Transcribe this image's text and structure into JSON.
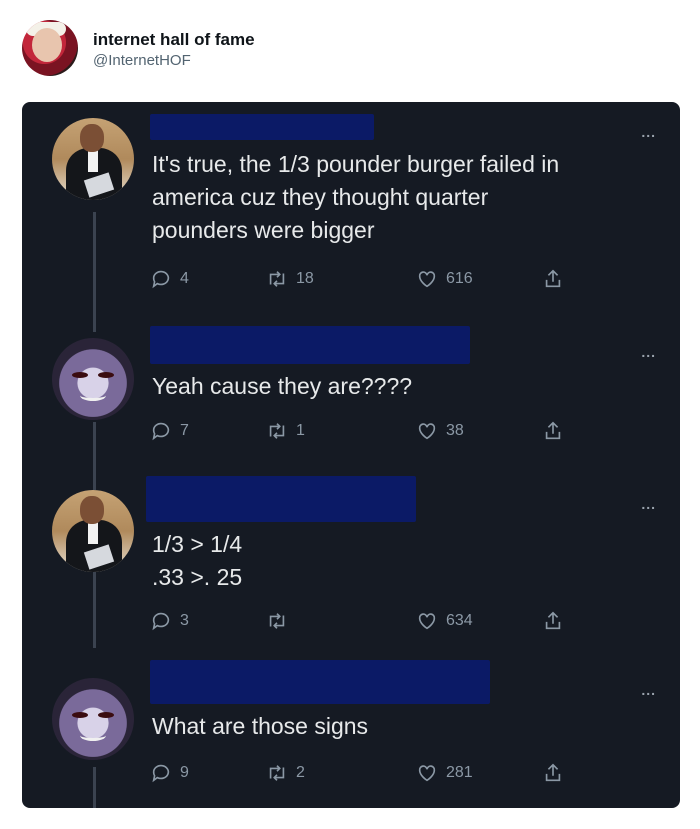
{
  "account": {
    "name": "internet hall of fame",
    "handle": "@InternetHOF"
  },
  "more_label": "...",
  "tweets": [
    {
      "lines": [
        "It's true, the 1/3 pounder burger failed in",
        "america cuz they thought quarter",
        "pounders were bigger"
      ],
      "replies": "4",
      "retweets": "18",
      "likes": "616"
    },
    {
      "lines": [
        "Yeah cause they are????"
      ],
      "replies": "7",
      "retweets": "1",
      "likes": "38"
    },
    {
      "lines": [
        "1/3 > 1/4",
        ".33 >. 25"
      ],
      "replies": "3",
      "retweets": "",
      "likes": "634"
    },
    {
      "lines": [
        "What are those signs"
      ],
      "replies": "9",
      "retweets": "2",
      "likes": "281"
    }
  ],
  "icons": {
    "reply": "reply-icon",
    "retweet": "retweet-icon",
    "like": "heart-icon",
    "share": "share-icon"
  },
  "colors": {
    "card_bg": "#151a23",
    "text": "#e7e9ea",
    "muted": "#8b98a5",
    "redaction": "#0b1a66"
  }
}
